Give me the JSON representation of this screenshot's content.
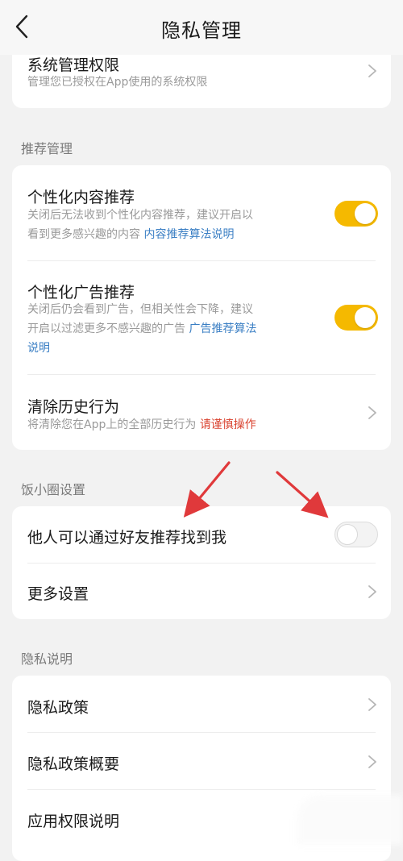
{
  "header": {
    "title": "隐私管理",
    "back_icon": "chevron-left-icon"
  },
  "card_system": {
    "title": "系统管理权限",
    "desc": "管理您已授权在App使用的系统权限"
  },
  "section_recommend": {
    "title": "推荐管理",
    "content_rec": {
      "title": "个性化内容推荐",
      "desc_line1": "关闭后无法收到个性化内容推荐，建议开启以",
      "desc_line2": "看到更多感兴趣的内容",
      "link": "内容推荐算法说明",
      "enabled": true
    },
    "ad_rec": {
      "title": "个性化广告推荐",
      "desc_line1": "关闭后仍会看到广告，但相关性会下降，建议",
      "desc_line2": "开启以过滤更多不感兴趣的广告",
      "link_part1": "广告推荐算法",
      "link_part2": "说明",
      "enabled": true
    },
    "clear_history": {
      "title": "清除历史行为",
      "desc": "将清除您在App上的全部历史行为",
      "warn": "请谨慎操作"
    }
  },
  "section_circle": {
    "title": "饭小圈设置",
    "find_me": {
      "title": "他人可以通过好友推荐找到我",
      "enabled": false
    },
    "more": {
      "title": "更多设置"
    }
  },
  "section_privacy": {
    "title": "隐私说明",
    "items": [
      {
        "title": "隐私政策"
      },
      {
        "title": "隐私政策概要"
      },
      {
        "title": "应用权限说明"
      }
    ]
  },
  "colors": {
    "toggle_on": "#f5b900",
    "link": "#3b7fc4",
    "warning": "#d9412e",
    "annotation_arrow": "#e0393b"
  }
}
